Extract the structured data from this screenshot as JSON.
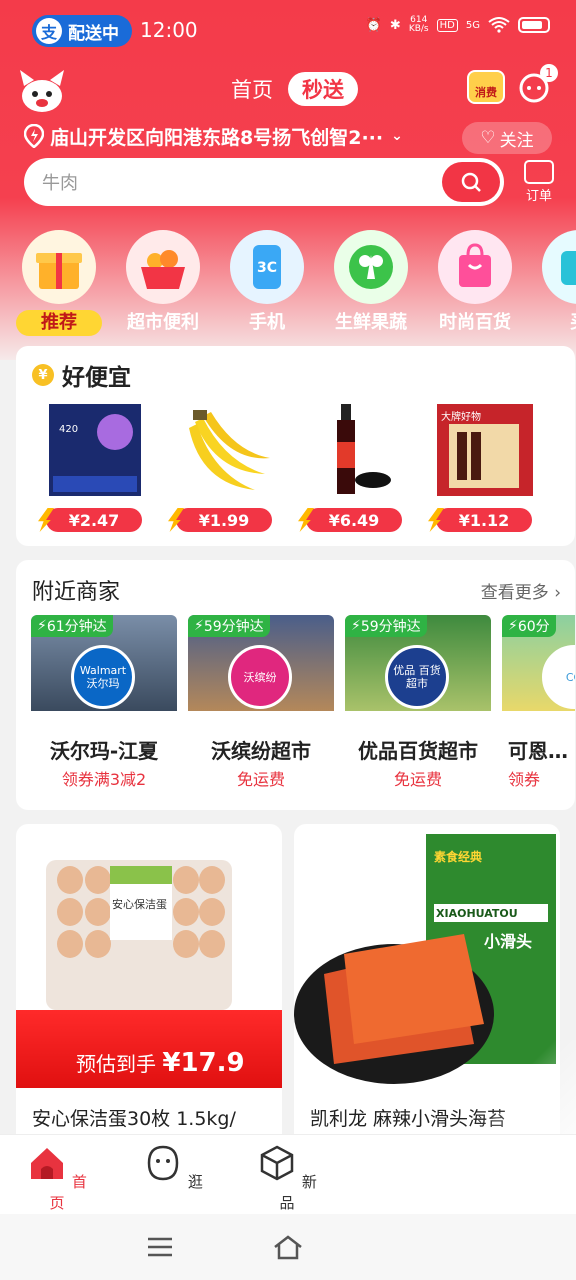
{
  "status_bar": {
    "pay_icon": "alipay-icon",
    "delivery_label": "配送中",
    "time": "12:00",
    "net_speed_value": "614",
    "net_speed_unit": "KB/s",
    "hd_label": "HD",
    "signal_label": "5G"
  },
  "header": {
    "tab_home": "首页",
    "tab_quick": "秒送",
    "coupon_label": "消费",
    "message_badge": "1",
    "location": "庙山开发区向阳港东路8号扬飞创智2···",
    "follow_label": "关注",
    "search_placeholder": "牛肉",
    "order_label": "订单"
  },
  "categories": [
    {
      "label": "推荐",
      "icon": "gift-box-icon"
    },
    {
      "label": "超市便利",
      "icon": "shopping-basket-icon"
    },
    {
      "label": "手机",
      "icon": "phone-3c-icon"
    },
    {
      "label": "生鲜果蔬",
      "icon": "vegetable-icon"
    },
    {
      "label": "时尚百货",
      "icon": "shopping-bag-icon"
    },
    {
      "label": "买",
      "icon": "more-category-icon"
    }
  ],
  "deals": {
    "title": "好便宜",
    "coin_symbol": "¥",
    "items": [
      {
        "price": "¥2.47",
        "image": "sanitary-pad-pack"
      },
      {
        "price": "¥1.99",
        "image": "banana-bunch"
      },
      {
        "price": "¥6.49",
        "image": "soy-sauce-bottle"
      },
      {
        "price": "¥1.12",
        "image": "snack-gift-box"
      }
    ],
    "snack_box_caption": "大牌好物"
  },
  "nearby": {
    "title": "附近商家",
    "more_label": "查看更多",
    "shops": [
      {
        "eta": "61分钟达",
        "name": "沃尔玛-江夏",
        "promo": "领券满3减2",
        "logo_text": "Walmart 沃尔玛",
        "logo_color": "#0a67c6"
      },
      {
        "eta": "59分钟达",
        "name": "沃缤纷超市",
        "promo": "免运费",
        "logo_text": "沃缤纷",
        "logo_color": "#e0277e"
      },
      {
        "eta": "59分钟达",
        "name": "优品百货超市",
        "promo": "免运费",
        "logo_text": "优品 百货超市",
        "logo_color": "#1c3f8f"
      },
      {
        "eta": "60分",
        "name": "可恩…",
        "promo": "领券",
        "logo_text": "CO",
        "logo_color": "#ffffff"
      }
    ]
  },
  "products": [
    {
      "name": "安心保洁蛋30枚 1.5kg/",
      "estimate_label": "预估到手",
      "estimate_price": "¥17.9",
      "pack_label": "安心保洁蛋"
    },
    {
      "name": "凯利龙 麻辣小滑头海苔",
      "brand_tag": "素食经典",
      "pack_label": "XIAOHUATOU",
      "pack_cn": "小滑头"
    }
  ],
  "bottom_nav": [
    {
      "label": "首页",
      "icon": "home-icon",
      "active": true
    },
    {
      "label": "逛",
      "icon": "face-icon",
      "active": false
    },
    {
      "label": "新品",
      "icon": "cube-icon",
      "active": false
    }
  ],
  "colors": {
    "brand_red": "#f23545",
    "eta_green": "#2fb344",
    "price_red": "#f23545",
    "promo_red": "#e8333f"
  }
}
